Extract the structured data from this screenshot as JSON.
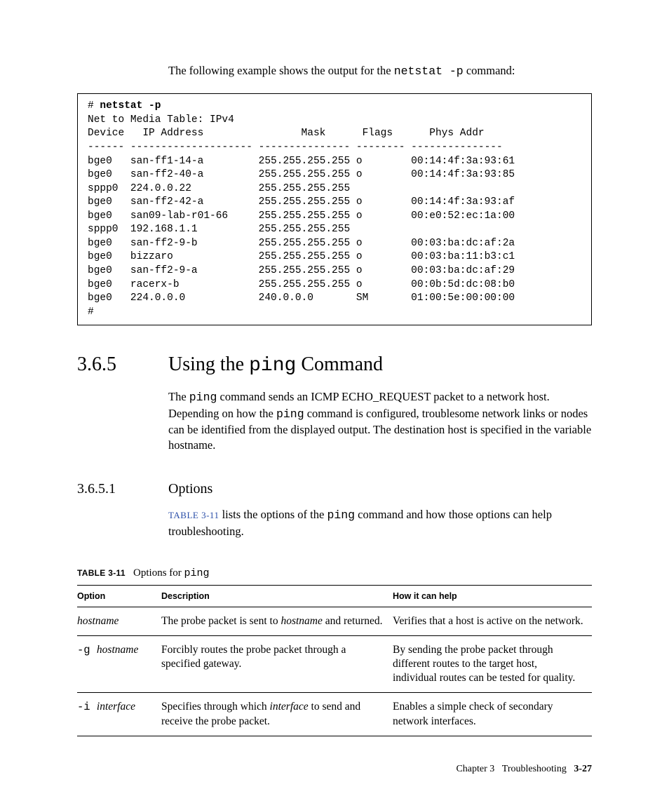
{
  "intro": {
    "pre": "The following example shows the output for the ",
    "cmd": "netstat -p",
    "post": " command:"
  },
  "code": {
    "prompt1": "# ",
    "cmd": "netstat -p",
    "header1": "Net to Media Table: IPv4",
    "header2": "Device   IP Address                Mask      Flags      Phys Addr",
    "rule": "------ -------------------- --------------- -------- ---------------",
    "rows": [
      "bge0   san-ff1-14-a         255.255.255.255 o        00:14:4f:3a:93:61",
      "bge0   san-ff2-40-a         255.255.255.255 o        00:14:4f:3a:93:85",
      "sppp0  224.0.0.22           255.255.255.255",
      "bge0   san-ff2-42-a         255.255.255.255 o        00:14:4f:3a:93:af",
      "bge0   san09-lab-r01-66     255.255.255.255 o        00:e0:52:ec:1a:00",
      "sppp0  192.168.1.1          255.255.255.255",
      "bge0   san-ff2-9-b          255.255.255.255 o        00:03:ba:dc:af:2a",
      "bge0   bizzaro              255.255.255.255 o        00:03:ba:11:b3:c1",
      "bge0   san-ff2-9-a          255.255.255.255 o        00:03:ba:dc:af:29",
      "bge0   racerx-b             255.255.255.255 o        00:0b:5d:dc:08:b0",
      "bge0   224.0.0.0            240.0.0.0       SM       01:00:5e:00:00:00"
    ],
    "prompt2": "#"
  },
  "section": {
    "num": "3.6.5",
    "title_pre": "Using the ",
    "title_code": "ping",
    "title_post": " Command",
    "para_parts": {
      "p1a": "The ",
      "p1b": "ping",
      "p1c": " command sends an ICMP ECHO_REQUEST packet to a network host. Depending on how the ",
      "p1d": "ping",
      "p1e": " command is configured, troublesome network links or nodes can be identified from the displayed output. The destination host is specified in the variable hostname."
    }
  },
  "subsection": {
    "num": "3.6.5.1",
    "title": "Options",
    "p_parts": {
      "xref": "TABLE 3-11",
      "mid": " lists the options of the ",
      "code": "ping",
      "end": " command and how those options can help troubleshooting."
    }
  },
  "table": {
    "caption_label": "TABLE 3-11",
    "caption_text": "Options for ",
    "caption_code": "ping",
    "head": {
      "opt": "Option",
      "desc": "Description",
      "help": "How it can help"
    },
    "rows": [
      {
        "opt_pre": "",
        "opt_code": "",
        "opt_ital": "hostname",
        "desc_pre": "The probe packet is sent to ",
        "desc_ital": "hostname",
        "desc_post": " and returned.",
        "help": "Verifies that a host is active on the network."
      },
      {
        "opt_pre": "",
        "opt_code": "-g ",
        "opt_ital": "hostname",
        "desc_pre": "Forcibly routes the probe packet through a specified gateway.",
        "desc_ital": "",
        "desc_post": "",
        "help": "By sending the probe packet through different routes to the target host, individual routes can be tested for quality."
      },
      {
        "opt_pre": "",
        "opt_code": "-i ",
        "opt_ital": "interface",
        "desc_pre": "Specifies through which ",
        "desc_ital": "interface",
        "desc_post": " to send and receive the probe packet.",
        "help": "Enables a simple check of secondary network interfaces."
      }
    ]
  },
  "footer": {
    "chapter": "Chapter 3",
    "title": "Troubleshooting",
    "page": "3-27"
  }
}
